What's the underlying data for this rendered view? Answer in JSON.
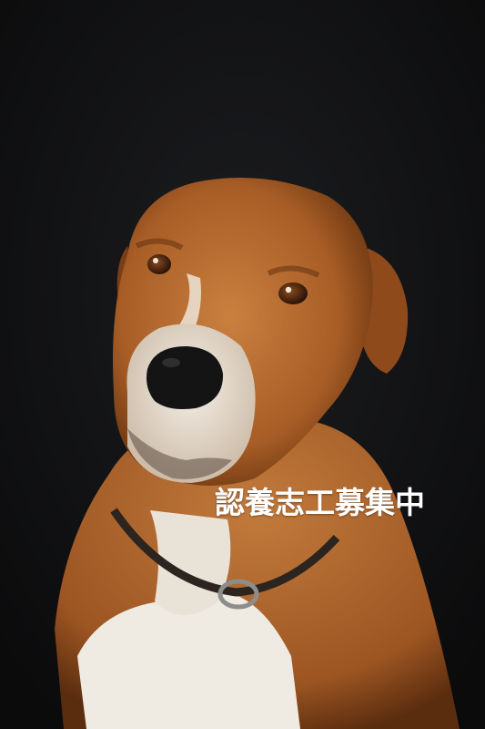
{
  "poster": {
    "caption": "認養志工募集中"
  },
  "colors": {
    "background": "#111214",
    "coat_primary": "#b86a2e",
    "coat_dark": "#7a3f17",
    "chest_white": "#f2efe9",
    "nose": "#141414",
    "caption_text": "#ffffff"
  },
  "icons": {
    "collar": "collar-ring-icon"
  }
}
